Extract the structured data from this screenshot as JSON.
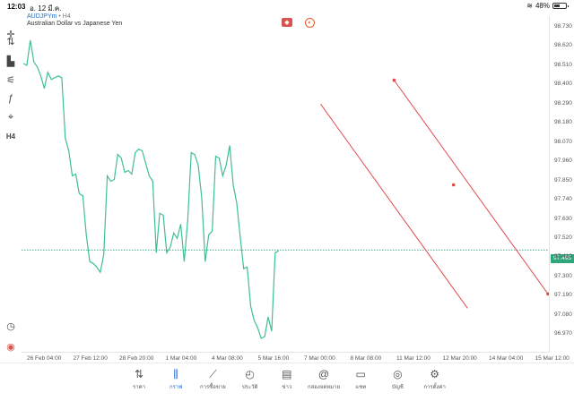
{
  "status": {
    "time": "12:03",
    "date": "อ. 12 มี.ค.",
    "battery": "48%",
    "battery_level": 0.48
  },
  "chart_header": {
    "symbol": "AUDJPYm",
    "separator": " • ",
    "timeframe": "H4",
    "description": "Australian Dollar vs Japanese Yen"
  },
  "toolbar": {
    "crosshair": "✛",
    "indicators": "⇅",
    "chart_type": "▙",
    "objects": "⚟",
    "function": "ƒ",
    "shapes": "⌖",
    "timeframe": "H4",
    "history": "◷",
    "brand": "◉"
  },
  "price_axis": {
    "labels": [
      "98.730",
      "98.620",
      "98.510",
      "98.400",
      "98.290",
      "98.180",
      "98.070",
      "97.960",
      "97.850",
      "97.740",
      "97.630",
      "97.520",
      "97.410",
      "97.300",
      "97.190",
      "97.080",
      "96.970"
    ],
    "current": "97.495"
  },
  "time_axis": {
    "labels": [
      "26 Feb 04:00",
      "27 Feb 12:00",
      "28 Feb 20:00",
      "1 Mar 04:00",
      "4 Mar 08:00",
      "5 Mar 16:00",
      "7 Mar 00:00",
      "8 Mar 08:00",
      "11 Mar 12:00",
      "12 Mar 20:00",
      "14 Mar 04:00",
      "15 Mar 12:00"
    ]
  },
  "chart_data": {
    "type": "line",
    "ylim": [
      96.925,
      98.805
    ],
    "values": [
      98.54,
      98.53,
      98.67,
      98.55,
      98.52,
      98.47,
      98.4,
      98.49,
      98.45,
      98.46,
      98.47,
      98.46,
      98.12,
      98.05,
      97.91,
      97.92,
      97.81,
      97.8,
      97.58,
      97.43,
      97.42,
      97.4,
      97.37,
      97.47,
      97.91,
      97.88,
      97.89,
      98.03,
      98.01,
      97.93,
      97.94,
      97.92,
      98.04,
      98.06,
      98.05,
      97.98,
      97.91,
      97.88,
      97.48,
      97.7,
      97.69,
      97.48,
      97.51,
      97.59,
      97.56,
      97.64,
      97.43,
      97.66,
      98.04,
      98.03,
      97.97,
      97.79,
      97.43,
      97.58,
      97.6,
      98.02,
      98.01,
      97.91,
      97.97,
      98.08,
      97.86,
      97.76,
      97.57,
      97.39,
      97.4,
      97.18,
      97.1,
      97.06,
      97.0,
      97.01,
      97.12,
      97.04,
      97.48,
      97.49
    ],
    "current_price": 97.495,
    "trendlines": [
      {
        "color": "#e04848",
        "p1": {
          "i": 85,
          "v": 98.312
        },
        "p2": {
          "i": 127,
          "v": 97.169
        }
      },
      {
        "color": "#e04848",
        "p1": {
          "i": 106,
          "v": 98.446
        },
        "p2": {
          "i": 150,
          "v": 97.249
        },
        "dots": [
          {
            "i": 106,
            "v": 98.446
          },
          {
            "i": 123,
            "v": 97.86
          },
          {
            "i": 150,
            "v": 97.249
          }
        ]
      }
    ],
    "total_slots": 150,
    "line_color": "#3fbf93",
    "price_line_color": "#2fa77a"
  },
  "nav": [
    {
      "key": "quotes",
      "icon": "⇅",
      "label": "ราคา",
      "active": false
    },
    {
      "key": "chart",
      "icon": "⫼",
      "label": "กราฟ",
      "active": true
    },
    {
      "key": "trade",
      "icon": "⟋",
      "label": "การซื้อขาย",
      "active": false
    },
    {
      "key": "history",
      "icon": "◴",
      "label": "ประวัติ",
      "active": false
    },
    {
      "key": "news",
      "icon": "▤",
      "label": "ข่าว",
      "active": false
    },
    {
      "key": "mailbox",
      "icon": "@",
      "label": "กล่องจดหมาย",
      "active": false
    },
    {
      "key": "chat",
      "icon": "▭",
      "label": "แชท",
      "active": false
    },
    {
      "key": "accounts",
      "icon": "◎",
      "label": "บัญชี",
      "active": false
    },
    {
      "key": "settings",
      "icon": "⚙",
      "label": "การตั้งค่า",
      "active": false
    }
  ]
}
